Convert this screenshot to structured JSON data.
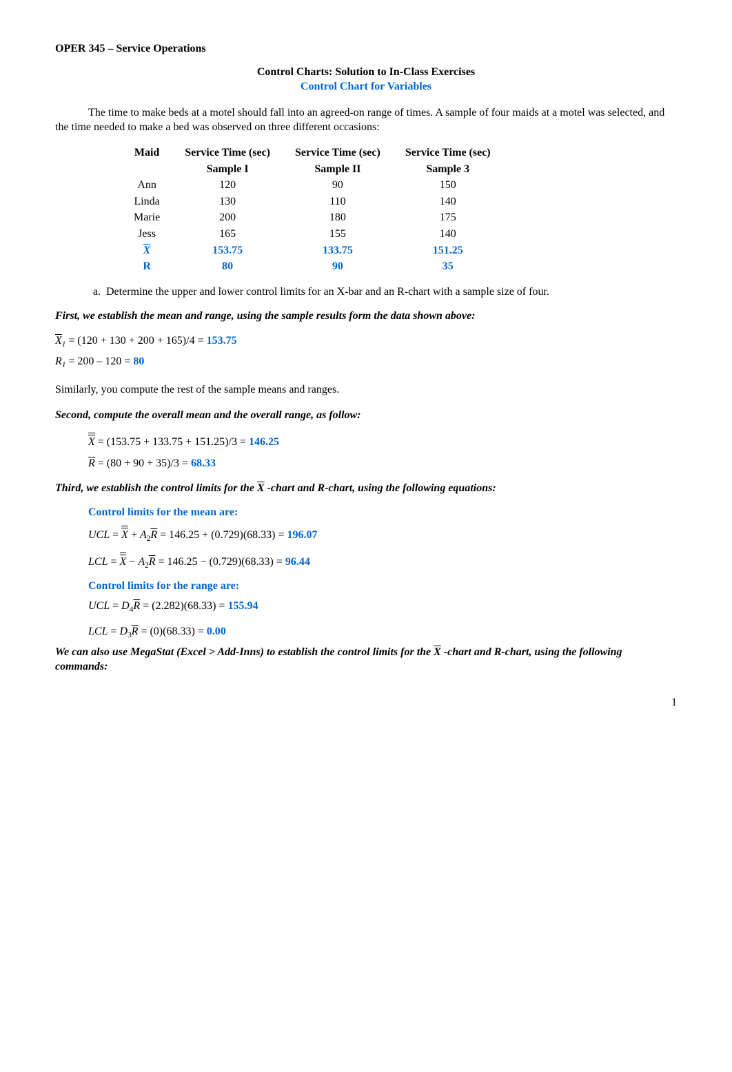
{
  "header": {
    "title": "OPER 345 – Service Operations"
  },
  "titles": {
    "line1": "Control Charts: Solution to In-Class Exercises",
    "line2": "Control Chart for Variables"
  },
  "intro": "The time to make beds at a motel should fall into an agreed-on range of times. A sample of four maids at a motel was selected, and the time needed to make a bed was observed on three different occasions:",
  "table": {
    "headers": [
      "Maid",
      "Service Time (sec)",
      "Service Time (sec)",
      "Service Time (sec)"
    ],
    "subheaders": [
      "",
      "Sample I",
      "Sample II",
      "Sample 3"
    ],
    "rows": [
      {
        "label": "Ann",
        "v": [
          "120",
          "90",
          "150"
        ]
      },
      {
        "label": "Linda",
        "v": [
          "130",
          "110",
          "140"
        ]
      },
      {
        "label": "Marie",
        "v": [
          "200",
          "180",
          "175"
        ]
      },
      {
        "label": "Jess",
        "v": [
          "165",
          "155",
          "140"
        ]
      }
    ],
    "xrow": {
      "label": "X̄",
      "v": [
        "153.75",
        "133.75",
        "151.25"
      ]
    },
    "rrow": {
      "label": "R",
      "v": [
        "80",
        "90",
        "35"
      ]
    }
  },
  "question_a": "Determine the upper and lower control limits for an X-bar and an R-chart with a sample size of four.",
  "steps": {
    "first": "First, we establish the mean and range, using the sample results form the data shown above:",
    "x1_lhs": "X̄",
    "x1_sub": "1",
    "x1_eq": " = (120 + 130 + 200 + 165)/4 = ",
    "x1_val": "153.75",
    "r1_lhs": "R",
    "r1_sub": "1",
    "r1_eq": " = 200 – 120 = ",
    "r1_val": "80",
    "similarly": "Similarly, you compute the rest of the sample means and ranges.",
    "second": "Second, compute the overall mean and the overall range, as follow:",
    "xbar_eq_pre": "X̄̄ = (153.75 + 133.75 + 151.25)/3 = ",
    "xbar_val": "146.25",
    "rbar_eq_pre": "R̄ = (80 + 90 + 35)/3 = ",
    "rbar_val": "68.33",
    "third_pre": "Third, we establish the control limits for the ",
    "third_mid": "X̄",
    "third_post": " -chart and R-chart, using the following equations:",
    "mean_label": "Control limits for the mean are:",
    "ucl_mean_pre": "UCL = X̄̄ + A₂R̄ = 146.25 + (0.729)(68.33) = ",
    "ucl_mean_val": "196.07",
    "lcl_mean_pre": "LCL = X̄̄ − A₂R̄ = 146.25 − (0.729)(68.33) = ",
    "lcl_mean_val": "96.44",
    "range_label": "Control limits for the range are:",
    "ucl_range_pre": "UCL = D₄R̄ = (2.282)(68.33) = ",
    "ucl_range_val": "155.94",
    "lcl_range_pre": "LCL = D₃R̄ = (0)(68.33) = ",
    "lcl_range_val": "0.00",
    "megastat_pre": "We can also use MegaStat (Excel > Add-Inns) to establish the control limits for the ",
    "megastat_mid": "X̄",
    "megastat_post": " -chart and R-chart, using the following commands:"
  },
  "pagenum": "1",
  "chart_data": {
    "type": "table",
    "title": "Bed-making service time samples",
    "columns": [
      "Maid",
      "Sample I (sec)",
      "Sample II (sec)",
      "Sample 3 (sec)"
    ],
    "rows": [
      [
        "Ann",
        120,
        90,
        150
      ],
      [
        "Linda",
        130,
        110,
        140
      ],
      [
        "Marie",
        200,
        180,
        175
      ],
      [
        "Jess",
        165,
        155,
        140
      ]
    ],
    "summary": {
      "sample_means": [
        153.75,
        133.75,
        151.25
      ],
      "sample_ranges": [
        80,
        90,
        35
      ],
      "grand_mean": 146.25,
      "mean_range": 68.33,
      "A2": 0.729,
      "D3": 0,
      "D4": 2.282,
      "mean_chart": {
        "UCL": 196.07,
        "LCL": 96.44
      },
      "range_chart": {
        "UCL": 155.94,
        "LCL": 0.0
      }
    }
  }
}
